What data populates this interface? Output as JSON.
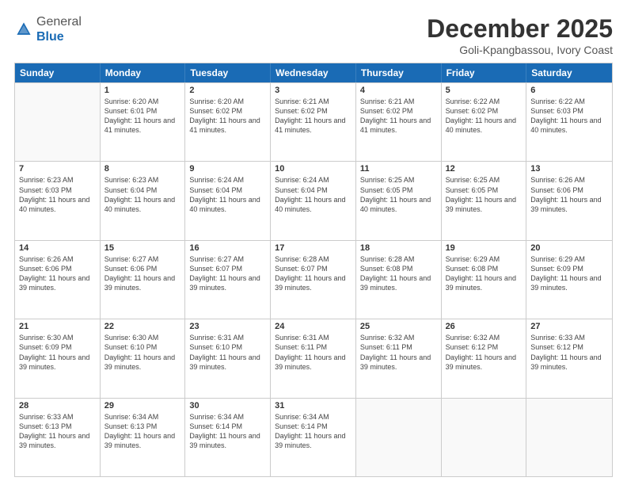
{
  "header": {
    "logo_general": "General",
    "logo_blue": "Blue",
    "title": "December 2025",
    "subtitle": "Goli-Kpangbassou, Ivory Coast"
  },
  "days_of_week": [
    "Sunday",
    "Monday",
    "Tuesday",
    "Wednesday",
    "Thursday",
    "Friday",
    "Saturday"
  ],
  "weeks": [
    [
      {
        "day": "",
        "info": ""
      },
      {
        "day": "1",
        "info": "Sunrise: 6:20 AM\nSunset: 6:01 PM\nDaylight: 11 hours and 41 minutes."
      },
      {
        "day": "2",
        "info": "Sunrise: 6:20 AM\nSunset: 6:02 PM\nDaylight: 11 hours and 41 minutes."
      },
      {
        "day": "3",
        "info": "Sunrise: 6:21 AM\nSunset: 6:02 PM\nDaylight: 11 hours and 41 minutes."
      },
      {
        "day": "4",
        "info": "Sunrise: 6:21 AM\nSunset: 6:02 PM\nDaylight: 11 hours and 41 minutes."
      },
      {
        "day": "5",
        "info": "Sunrise: 6:22 AM\nSunset: 6:02 PM\nDaylight: 11 hours and 40 minutes."
      },
      {
        "day": "6",
        "info": "Sunrise: 6:22 AM\nSunset: 6:03 PM\nDaylight: 11 hours and 40 minutes."
      }
    ],
    [
      {
        "day": "7",
        "info": "Sunrise: 6:23 AM\nSunset: 6:03 PM\nDaylight: 11 hours and 40 minutes."
      },
      {
        "day": "8",
        "info": "Sunrise: 6:23 AM\nSunset: 6:04 PM\nDaylight: 11 hours and 40 minutes."
      },
      {
        "day": "9",
        "info": "Sunrise: 6:24 AM\nSunset: 6:04 PM\nDaylight: 11 hours and 40 minutes."
      },
      {
        "day": "10",
        "info": "Sunrise: 6:24 AM\nSunset: 6:04 PM\nDaylight: 11 hours and 40 minutes."
      },
      {
        "day": "11",
        "info": "Sunrise: 6:25 AM\nSunset: 6:05 PM\nDaylight: 11 hours and 40 minutes."
      },
      {
        "day": "12",
        "info": "Sunrise: 6:25 AM\nSunset: 6:05 PM\nDaylight: 11 hours and 39 minutes."
      },
      {
        "day": "13",
        "info": "Sunrise: 6:26 AM\nSunset: 6:06 PM\nDaylight: 11 hours and 39 minutes."
      }
    ],
    [
      {
        "day": "14",
        "info": "Sunrise: 6:26 AM\nSunset: 6:06 PM\nDaylight: 11 hours and 39 minutes."
      },
      {
        "day": "15",
        "info": "Sunrise: 6:27 AM\nSunset: 6:06 PM\nDaylight: 11 hours and 39 minutes."
      },
      {
        "day": "16",
        "info": "Sunrise: 6:27 AM\nSunset: 6:07 PM\nDaylight: 11 hours and 39 minutes."
      },
      {
        "day": "17",
        "info": "Sunrise: 6:28 AM\nSunset: 6:07 PM\nDaylight: 11 hours and 39 minutes."
      },
      {
        "day": "18",
        "info": "Sunrise: 6:28 AM\nSunset: 6:08 PM\nDaylight: 11 hours and 39 minutes."
      },
      {
        "day": "19",
        "info": "Sunrise: 6:29 AM\nSunset: 6:08 PM\nDaylight: 11 hours and 39 minutes."
      },
      {
        "day": "20",
        "info": "Sunrise: 6:29 AM\nSunset: 6:09 PM\nDaylight: 11 hours and 39 minutes."
      }
    ],
    [
      {
        "day": "21",
        "info": "Sunrise: 6:30 AM\nSunset: 6:09 PM\nDaylight: 11 hours and 39 minutes."
      },
      {
        "day": "22",
        "info": "Sunrise: 6:30 AM\nSunset: 6:10 PM\nDaylight: 11 hours and 39 minutes."
      },
      {
        "day": "23",
        "info": "Sunrise: 6:31 AM\nSunset: 6:10 PM\nDaylight: 11 hours and 39 minutes."
      },
      {
        "day": "24",
        "info": "Sunrise: 6:31 AM\nSunset: 6:11 PM\nDaylight: 11 hours and 39 minutes."
      },
      {
        "day": "25",
        "info": "Sunrise: 6:32 AM\nSunset: 6:11 PM\nDaylight: 11 hours and 39 minutes."
      },
      {
        "day": "26",
        "info": "Sunrise: 6:32 AM\nSunset: 6:12 PM\nDaylight: 11 hours and 39 minutes."
      },
      {
        "day": "27",
        "info": "Sunrise: 6:33 AM\nSunset: 6:12 PM\nDaylight: 11 hours and 39 minutes."
      }
    ],
    [
      {
        "day": "28",
        "info": "Sunrise: 6:33 AM\nSunset: 6:13 PM\nDaylight: 11 hours and 39 minutes."
      },
      {
        "day": "29",
        "info": "Sunrise: 6:34 AM\nSunset: 6:13 PM\nDaylight: 11 hours and 39 minutes."
      },
      {
        "day": "30",
        "info": "Sunrise: 6:34 AM\nSunset: 6:14 PM\nDaylight: 11 hours and 39 minutes."
      },
      {
        "day": "31",
        "info": "Sunrise: 6:34 AM\nSunset: 6:14 PM\nDaylight: 11 hours and 39 minutes."
      },
      {
        "day": "",
        "info": ""
      },
      {
        "day": "",
        "info": ""
      },
      {
        "day": "",
        "info": ""
      }
    ]
  ]
}
